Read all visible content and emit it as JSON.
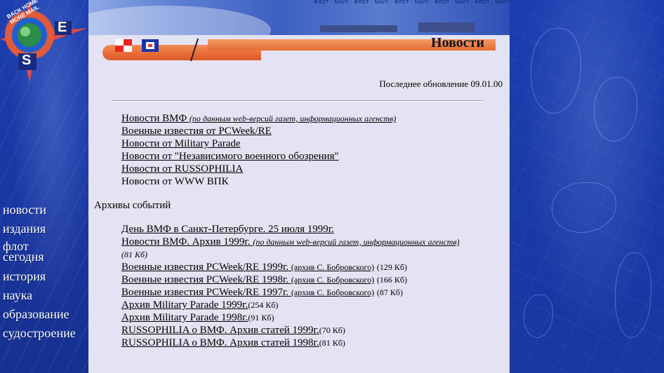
{
  "header": {
    "navy_strip": "ФЛОТ · NAVY · ФЛОТ · NAVY · ФЛОТ · NAVY · ФЛОТ · NAVY · ФЛОТ · NAVY"
  },
  "logo": {
    "ring_text": "BACK HOME MORE MAIL",
    "letter_east": "E",
    "letter_south": "S"
  },
  "page": {
    "title": "Новости",
    "updated": "Последнее обновление 09.01.00"
  },
  "news_links": [
    {
      "label": "Новости ВМФ",
      "note": "(по данным web-версий газет, информационных агенств)"
    },
    {
      "label": "Военные известия от PCWeek/RE"
    },
    {
      "label": "Новости от Military Parade"
    },
    {
      "label": "Новости от \"Независимого военного обозрения\""
    },
    {
      "label": "Новости от RUSSOPHILIA"
    },
    {
      "label": "Новости от WWW ВПК",
      "plain": true
    }
  ],
  "archive": {
    "heading": "Архивы событий",
    "items": [
      {
        "label": "День ВМФ в Санкт-Петербурге. 25 июля 1999г."
      },
      {
        "label": "Новости ВМФ. Архив 1999г.",
        "note": "(по данным web-версий газет, информационных агенств)",
        "size": "(81 Кб)"
      },
      {
        "label": "Военные известия PCWeek/RE 1999г.",
        "sub": "(архив С. Бобровского)",
        "size": "(129 Кб)"
      },
      {
        "label": "Военные известия PCWeek/RE 1998г.",
        "sub": "(архив С. Бобровского)",
        "size": "(166 Кб)"
      },
      {
        "label": "Военные известия PCWeek/RE 1997г.",
        "sub": "(архив С. Бобровского)",
        "size": "(87 Кб)"
      },
      {
        "label": "Архив Military Parade 1999г.",
        "size": "(254 Кб)"
      },
      {
        "label": "Архив Military Parade 1998г.",
        "size": "(91 Кб)"
      },
      {
        "label": "RUSSOPHILIA о ВМФ. Архив статей 1999г.",
        "size": "(70 Кб)"
      },
      {
        "label": "RUSSOPHILIA о ВМФ. Архив статей 1998г.",
        "size": "(81 Кб)"
      }
    ]
  },
  "sidenav": [
    "новости",
    "издания",
    "флот сегодня",
    "история",
    "наука",
    "образование",
    "судостроение"
  ],
  "colors": {
    "accent_orange": "#e86a34",
    "navy": "#1a3aa0",
    "panel": "#e3e3f3"
  }
}
